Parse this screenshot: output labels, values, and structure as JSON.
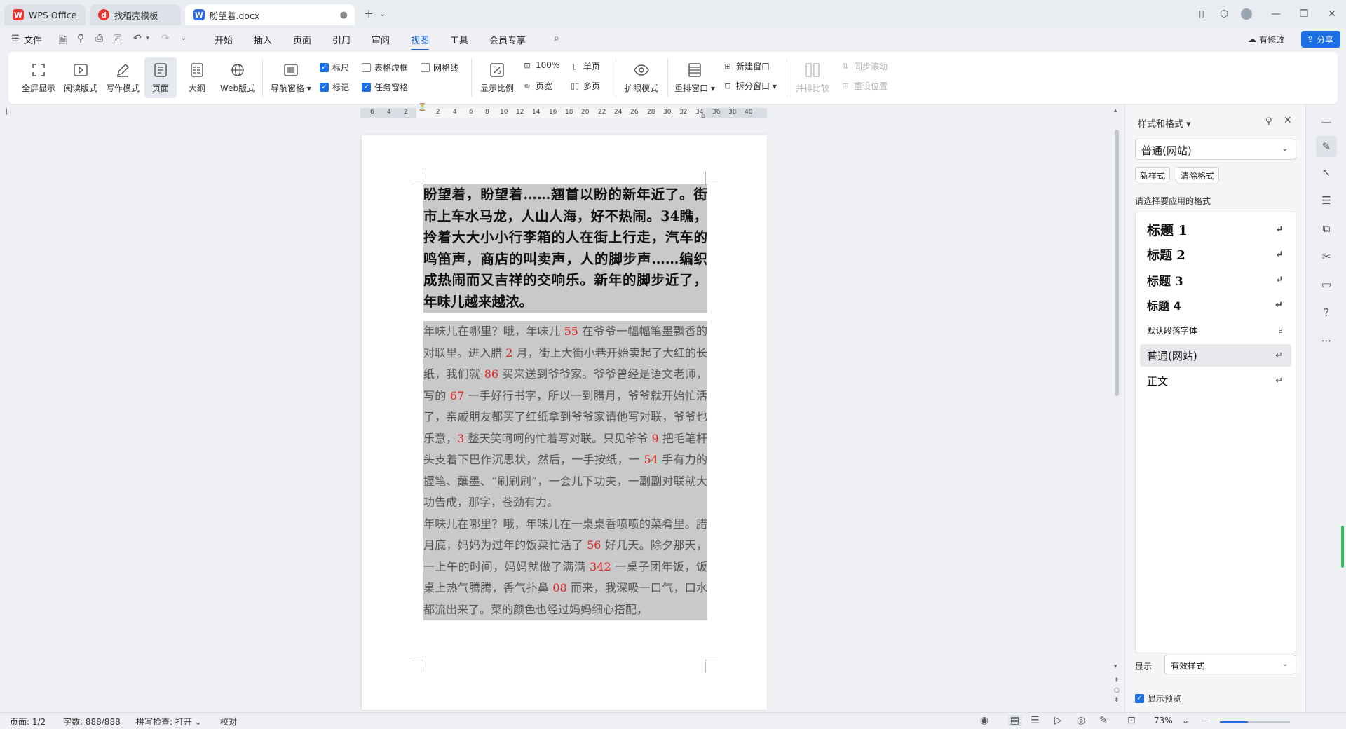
{
  "tabs": [
    {
      "label": "WPS Office",
      "icon": "wps-logo-icon"
    },
    {
      "label": "找稻壳模板",
      "icon": "docer-icon"
    },
    {
      "label": "盼望着.docx",
      "icon": "word-doc-icon",
      "active": true
    }
  ],
  "menu": {
    "file": "文件",
    "items": [
      "开始",
      "插入",
      "页面",
      "引用",
      "审阅",
      "视图",
      "工具",
      "会员专享"
    ],
    "active": "视图",
    "modified": "有修改",
    "share": "分享"
  },
  "ribbon": {
    "fullscreen": "全屏显示",
    "read_mode": "阅读版式",
    "write_mode": "写作模式",
    "page": "页面",
    "outline": "大纲",
    "web": "Web版式",
    "nav_pane": "导航窗格",
    "ruler": "标尺",
    "marks": "标记",
    "table_grid": "表格虚框",
    "task_pane": "任务窗格",
    "gridlines": "网格线",
    "zoom": "显示比例",
    "zoom_100": "100%",
    "page_width": "页宽",
    "single_page": "单页",
    "multi_page": "多页",
    "eye_mode": "护眼模式",
    "rearrange": "重排窗口",
    "new_window": "新建窗口",
    "split_window": "拆分窗口",
    "side_by_side": "并排比较",
    "sync_scroll": "同步滚动",
    "reset_pos": "重设位置"
  },
  "ruler_ticks": [
    "6",
    "4",
    "2",
    "2",
    "4",
    "6",
    "8",
    "10",
    "12",
    "14",
    "16",
    "18",
    "20",
    "22",
    "24",
    "26",
    "28",
    "30",
    "32",
    "34",
    "36",
    "38",
    "40"
  ],
  "document": {
    "heading_paragraph": "盼望着，盼望着……翘首以盼的新年近了。街市上车水马龙，人山人海，好不热闹。34瞧，拎着大大小小行李箱的人在街上行走，汽车的鸣笛声，商店的叫卖声，人的脚步声……编织成热闹而又吉祥的交响乐。新年的脚步近了，年味儿越来越浓。",
    "para1": [
      {
        "t": "年味儿在哪里？哦，年味儿 "
      },
      {
        "t": "55",
        "red": true
      },
      {
        "t": " 在爷爷一幅幅笔墨飘香的对联里。进入腊 "
      },
      {
        "t": "2",
        "red": true
      },
      {
        "t": " 月，街上大街小巷开始卖起了大红的长纸，我们就 "
      },
      {
        "t": "86",
        "red": true
      },
      {
        "t": " 买来送到爷爷家。爷爷曾经是语文老师，写的 "
      },
      {
        "t": "67",
        "red": true
      },
      {
        "t": " 一手好行书字，所以一到腊月，爷爷就开始忙活了，亲戚朋友都买了红纸拿到爷爷家请他写对联，爷爷也乐意，"
      },
      {
        "t": "3",
        "red": true
      },
      {
        "t": " 整天笑呵呵的忙着写对联。只见爷爷 "
      },
      {
        "t": "9",
        "red": true
      },
      {
        "t": " 把毛笔杆头支着下巴作沉思状，然后，一手按纸，一 "
      },
      {
        "t": "54",
        "red": true
      },
      {
        "t": " 手有力的握笔、蘸墨、“刷刷刷”，一会儿下功夫，一副副对联就大功告成，那字，苍劲有力。"
      }
    ],
    "para2": [
      {
        "t": "年味儿在哪里？哦，年味儿在一桌桌香喷喷的菜肴里。腊月底，妈妈为过年的饭菜忙活了 "
      },
      {
        "t": "56",
        "red": true
      },
      {
        "t": " 好几天。除夕那天，一上午的时间，妈妈就做了满满 "
      },
      {
        "t": "342",
        "red": true
      },
      {
        "t": " 一桌子团年饭，饭桌上热气腾腾，香气扑鼻 "
      },
      {
        "t": "08",
        "red": true
      },
      {
        "t": " 而来，我深吸一口气，口水都流出来了。菜的颜色也经过妈妈细心搭配，"
      }
    ]
  },
  "panel": {
    "title": "样式和格式",
    "current_style": "普通(网站)",
    "new_style": "新样式",
    "clear_format": "清除格式",
    "apply_label": "请选择要应用的格式",
    "styles": [
      {
        "name": "标题  1",
        "kind": "h1"
      },
      {
        "name": "标题  2",
        "kind": "h2"
      },
      {
        "name": "标题  3",
        "kind": "h3"
      },
      {
        "name": "标题  4",
        "kind": "h4"
      },
      {
        "name": "默认段落字体",
        "kind": "char"
      },
      {
        "name": "普通(网站)",
        "kind": "sel"
      },
      {
        "name": "正文",
        "kind": "normal"
      }
    ],
    "show_label": "显示",
    "show_value": "有效样式",
    "preview_label": "显示预览"
  },
  "status": {
    "page": "页面: 1/2",
    "words": "字数: 888/888",
    "spell": "拼写检查: 打开",
    "proof": "校对",
    "zoom": "73%"
  },
  "colors": {
    "accent": "#1a5fd6",
    "number_red": "#e02020",
    "selection": "#c9c9c9"
  }
}
